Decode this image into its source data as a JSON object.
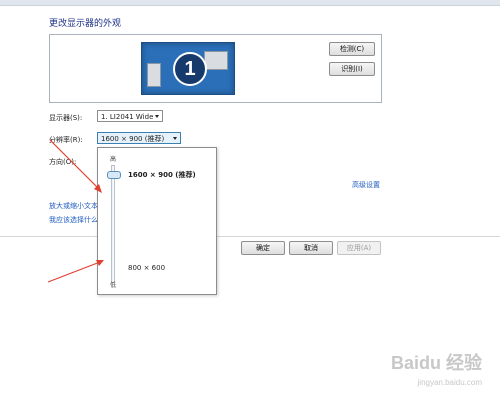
{
  "window": {
    "title": "更改显示器的外观"
  },
  "preview": {
    "monitor_number": "1",
    "detect_button": "检测(C)",
    "identify_button": "识别(I)"
  },
  "settings": {
    "display_label": "显示器(S):",
    "display_value": "1. LI2041 Wide",
    "resolution_label": "分辨率(R):",
    "resolution_value": "1600 × 900 (推荐)",
    "orientation_label": "方向(O):",
    "advanced_link": "高级设置"
  },
  "links": {
    "text_size": "放大或缩小文本",
    "which_settings": "我应该选择什么"
  },
  "dropdown": {
    "high_label": "高",
    "low_label": "低",
    "top_resolution": "1600 × 900 (推荐)",
    "bottom_resolution": "800 × 600",
    "slider_value": 1.0
  },
  "footer": {
    "ok_button": "确定",
    "cancel_button": "取消",
    "apply_button": "应用(A)"
  },
  "watermark": {
    "logo": "Baidu 经验",
    "url": "jingyan.baidu.com"
  },
  "colors": {
    "title": "#1e3287",
    "link": "#1e5bbf",
    "annotation_arrow": "#e0402f",
    "monitor": "#2a6fb8"
  }
}
